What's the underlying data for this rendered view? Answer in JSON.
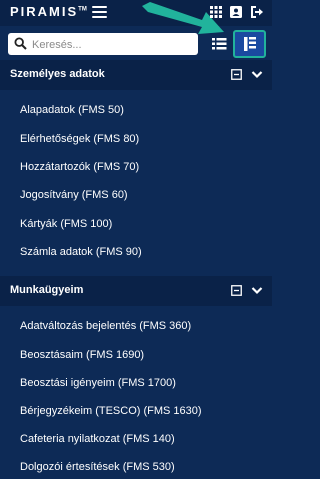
{
  "header": {
    "logo_text": "PIRAMIS",
    "logo_tm": "TM",
    "icons": [
      "menu-icon",
      "apps-grid-icon",
      "contact-card-icon",
      "logout-icon"
    ]
  },
  "search": {
    "placeholder": "Keresés...",
    "value": ""
  },
  "sections": [
    {
      "title": "Személyes adatok",
      "items": [
        "Alapadatok (FMS 50)",
        "Elérhetőségek (FMS 80)",
        "Hozzátartozók (FMS 70)",
        "Jogosítvány (FMS 60)",
        "Kártyák (FMS 100)",
        "Számla adatok (FMS 90)"
      ]
    },
    {
      "title": "Munkaügyeim",
      "items": [
        "Adatváltozás bejelentés (FMS 360)",
        "Beosztásaim (FMS 1690)",
        "Beosztási igényeim (FMS 1700)",
        "Bérjegyzékeim (TESCO) (FMS 1630)",
        "Cafeteria nyilatkozat (FMS 140)",
        "Dolgozói értesítések (FMS 530)"
      ]
    }
  ],
  "colors": {
    "background": "#0d2a56",
    "topbar": "#0a2248",
    "accent": "#21b39c",
    "selected_view": "#1a4aa0"
  }
}
